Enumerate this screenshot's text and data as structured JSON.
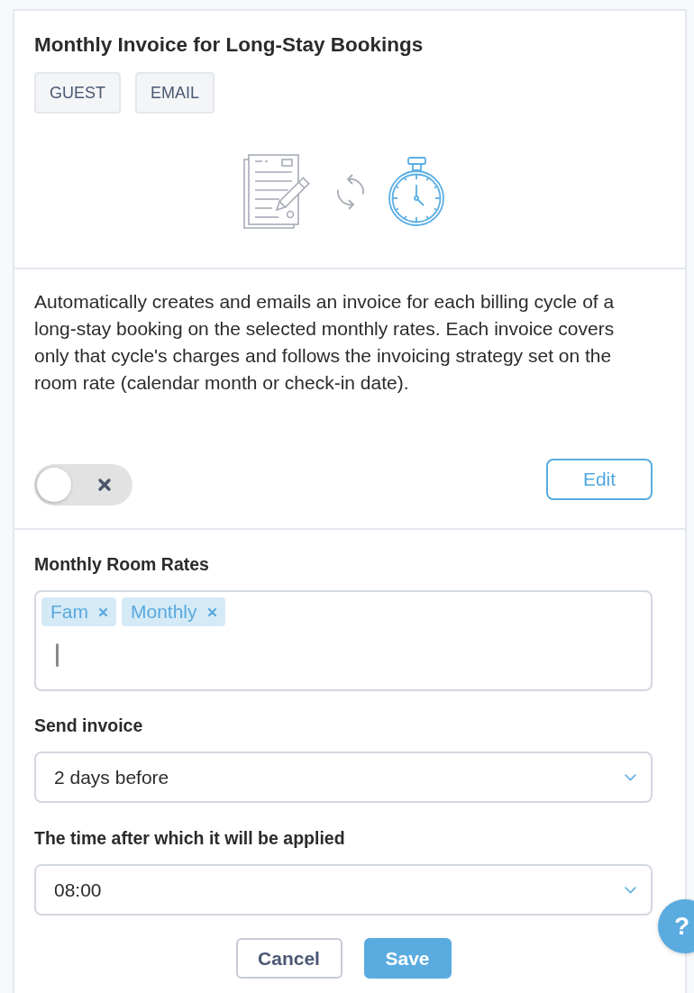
{
  "card": {
    "title": "Monthly Invoice for Long-Stay Bookings",
    "tags": [
      "GUEST",
      "EMAIL"
    ],
    "description": "Automatically creates and emails an invoice for each billing cycle of a long-stay booking on the selected monthly rates. Each invoice covers only that cycle's charges and follows the invoicing strategy set on the room rate (calendar month or check-in date).",
    "toggle": {
      "on": false
    },
    "edit_button": "Edit"
  },
  "form": {
    "fields": [
      {
        "kind": "tags",
        "label": "Monthly Room Rates",
        "chips": [
          "Fam",
          "Monthly"
        ]
      },
      {
        "kind": "select",
        "label": "Send invoice",
        "value": "2 days before"
      },
      {
        "kind": "select",
        "label": "The time after which it will be applied",
        "value": "08:00"
      }
    ],
    "buttons": [
      {
        "kind": "secondary",
        "label": "Cancel"
      },
      {
        "kind": "primary",
        "label": "Save"
      }
    ]
  },
  "help_button": {
    "label": "?"
  }
}
